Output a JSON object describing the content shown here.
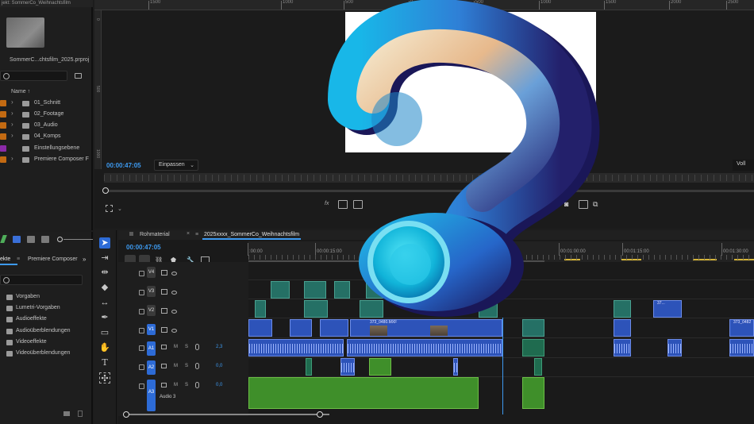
{
  "project": {
    "tab_title": "jekt: SommerCo_Weihnachtsfilm",
    "file_name": "SommerC...chtsfilm_2025.prproj",
    "column_name": "Name ↑",
    "bins": [
      {
        "label": "01_Schnitt",
        "color": "#c36a12"
      },
      {
        "label": "02_Footage",
        "color": "#c36a12"
      },
      {
        "label": "03_Audio",
        "color": "#c36a12"
      },
      {
        "label": "04_Komps",
        "color": "#c36a12"
      },
      {
        "label": "Einstellungsebene",
        "color": "#8b2aa8"
      },
      {
        "label": "Premiere Composer F",
        "color": "#c36a12"
      }
    ]
  },
  "effects": {
    "tab_effects": "ekte",
    "tab_composer": "Premiere Composer",
    "items": [
      "Vorgaben",
      "Lumetri-Vorgaben",
      "Audioeffekte",
      "Audioüberblendungen",
      "Videoeffekte",
      "Videoüberblendungen"
    ]
  },
  "monitor": {
    "ruler_labels": [
      "1500",
      "1000",
      "500",
      "0",
      "500",
      "1000",
      "1500",
      "2000",
      "2500",
      "3000"
    ],
    "vruler_labels": [
      "0",
      "500",
      "1000"
    ],
    "timecode": "00:00:47:05",
    "fit_label": "Einpassen",
    "quality_label": "Voll",
    "fx_label": "fx"
  },
  "timeline": {
    "tabs": [
      "Rohmaterial",
      "2025xxxx_SommerCo_Weihnachtsfilm"
    ],
    "timecode": "00:00:47:05",
    "ruler_labels": [
      ":00:00",
      "00:00:15:00",
      "00:01:00:00",
      "00:01:15:00",
      "00:01:30:00"
    ],
    "video_tracks": [
      "V4",
      "V3",
      "V2",
      "V1"
    ],
    "audio_tracks": [
      {
        "label": "A1",
        "volume": "2,3"
      },
      {
        "label": "A2",
        "volume": "0,0"
      },
      {
        "label": "A3",
        "volume": "0,0",
        "name": "Audio 3"
      }
    ],
    "clip_names": {
      "v1_main": "373_0480.MXF",
      "v1_end": "373_0482",
      "v2_clip": "37..."
    },
    "mute_label": "M",
    "solo_label": "S",
    "fx_label": "fx"
  },
  "colors": {
    "accent_blue": "#3d9af0",
    "clip_video": "#2d53b9",
    "clip_audio_green": "#3f8f2a",
    "transition_teal": "#257065",
    "label_orange": "#c36a12",
    "label_purple": "#8b2aa8"
  },
  "overlay": {
    "icon": "question-mark-icon"
  }
}
